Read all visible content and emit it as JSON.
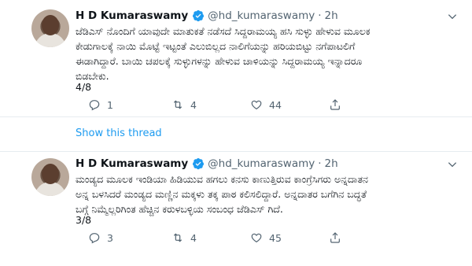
{
  "tweets": [
    {
      "name": "H D Kumaraswamy",
      "handle": "@hd_kumaraswamy",
      "separator": "·",
      "time": "2h",
      "text": "ಜೆಡಿಎಸ್ ನೊಂದಿಗೆ ಯಾವುದೇ ಮಾತುಕತೆ  ನಡೆಸದೆ ಸಿದ್ದರಾಮಯ್ಯ ಹಸಿ ಸುಳ್ಳು ಹೇಳುವ ಮೂಲಕ\nಕೇಡುಗಾಲಕ್ಕೆ ನಾಯಿ ಮೊಟ್ಟೆ ಇಟ್ಟಂತೆ ಎಲುಬಿಲ್ಲದ ನಾಲಿಗೆಯನ್ನು ಹರಿಯಬಿಟ್ಟು ನಗೆಪಾಟಲಿಗೆ\nಈಡಾಗಿದ್ದಾರೆ. ಬಾಯಿ ಚಪಲಕ್ಕೆ ಸುಳ್ಳುಗಳನ್ನು ಹೇಳುವ  ಚಾಳಿಯನ್ನು ಸಿದ್ದರಾಮಯ್ಯ ಇನ್ನಾದರೂ\nಬಿಡಬೇಕು.",
      "counter": "4/8",
      "replies": "1",
      "retweets": "4",
      "likes": "44"
    },
    {
      "name": "H D Kumaraswamy",
      "handle": "@hd_kumaraswamy",
      "separator": "·",
      "time": "2h",
      "text": "ಮಂಡ್ಯದ ಮೂಲಕ ಇಂಡಿಯಾ ಹಿಡಿಯುವ  ಹಗಲು ಕನಸು ಕಾಣುತ್ತಿರುವ ಕಾಂಗ್ರೆಸಿಗರು ಅನ್ನದಾತನ\nಅನ್ನ ಬಳಸಿದರೆ ಮಂಡ್ಯದ ಮಣ್ಣಿನ ಮಕ್ಕಳು ತಕ್ಕ ಪಾಠ ಕಲಿಸಲಿದ್ದಾರೆ. ಅನ್ನದಾತರ ಬಗೆಗಿನ ಬದ್ಧತೆ\nಬಗ್ಗೆ ನಿಮ್ಮೆಲ್ಲರಿಗಿಂತ ಹೆಚ್ಚಿನ ಕರುಳಬಳ್ಳಿಯ ಸಂಬಂಧ ಜೆಡಿಎಸ್ ಗಿದೆ.",
      "counter": "3/8",
      "replies": "3",
      "retweets": "4",
      "likes": "45"
    }
  ],
  "thread": {
    "show_label": "Show this thread"
  },
  "colors": {
    "accent": "#1d9bf0",
    "muted": "#536471",
    "divider": "#e6ecf0"
  },
  "icons": [
    "verified-badge-icon",
    "chevron-down-icon",
    "reply-icon",
    "retweet-icon",
    "like-icon",
    "share-icon"
  ]
}
